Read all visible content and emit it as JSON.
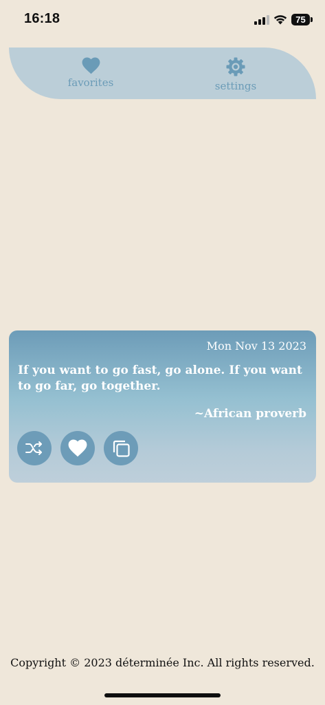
{
  "status_bar": {
    "time": "16:18",
    "battery": "75"
  },
  "nav": {
    "favorites_label": "favorites",
    "settings_label": "settings",
    "favorites_icon": "heart-icon",
    "settings_icon": "gear-icon"
  },
  "quote": {
    "date": "Mon Nov 13 2023",
    "text": "If you want to go fast, go alone. If you want to go far, go together.",
    "author": "~African proverb"
  },
  "actions": {
    "shuffle_icon": "shuffle-icon",
    "favorite_icon": "heart-icon",
    "copy_icon": "copy-icon"
  },
  "footer": {
    "copyright": "Copyright © 2023 déterminée Inc. All rights reserved."
  },
  "colors": {
    "background": "#EFE7DA",
    "nav_background": "#BBCED8",
    "accent": "#6D9CB8",
    "card_top": "#6D9CB8",
    "card_bottom": "#BECFDA"
  }
}
